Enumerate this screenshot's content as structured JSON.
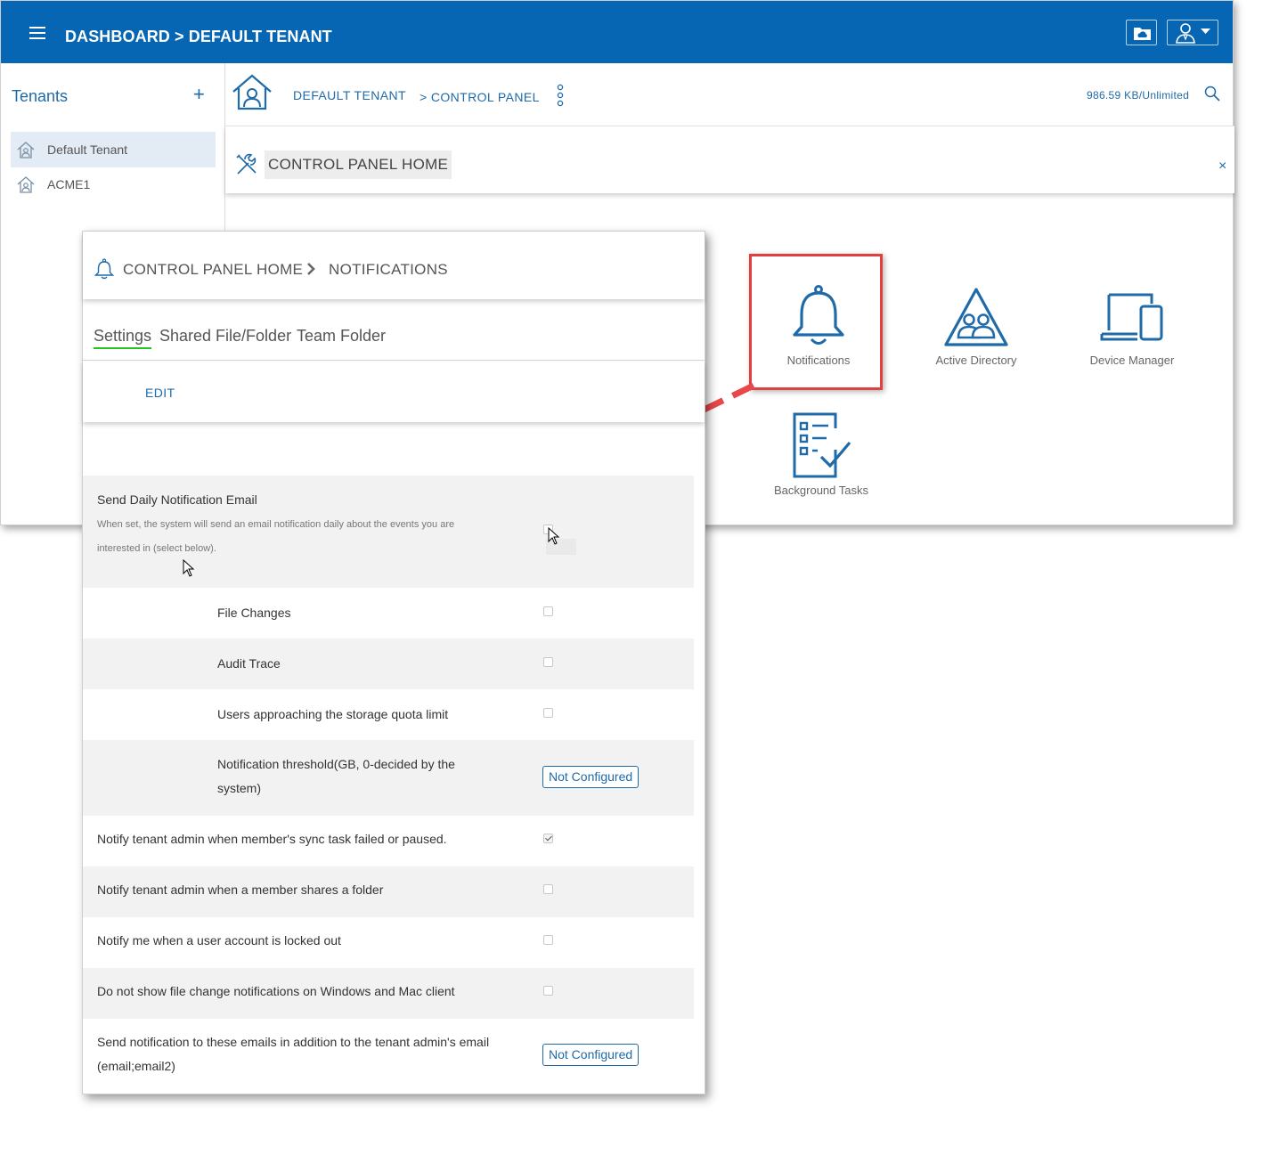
{
  "topbar": {
    "title": "DASHBOARD > DEFAULT TENANT"
  },
  "sidebar": {
    "title": "Tenants",
    "add_label": "+",
    "items": [
      {
        "label": "Default Tenant",
        "selected": true
      },
      {
        "label": "ACME1",
        "selected": false
      }
    ]
  },
  "breadcrumb": {
    "tenant": "DEFAULT TENANT",
    "control_panel": "> CONTROL PANEL"
  },
  "quota": "986.59 KB/Unlimited",
  "cp_header": {
    "title": "CONTROL PANEL HOME",
    "close_glyph": "×"
  },
  "tiles": [
    {
      "label": "Notifications",
      "icon": "bell-icon"
    },
    {
      "label": "Active Directory",
      "icon": "active-directory-icon"
    },
    {
      "label": "Device Manager",
      "icon": "device-manager-icon"
    },
    {
      "label": "Background Tasks",
      "icon": "checklist-icon"
    }
  ],
  "panel": {
    "crumb_home": "CONTROL PANEL HOME",
    "crumb_current": "NOTIFICATIONS",
    "tabs": [
      {
        "label": "Settings",
        "active": true
      },
      {
        "label": "Shared File/Folder",
        "active": false
      },
      {
        "label": "Team Folder",
        "active": false
      }
    ],
    "edit_label": "EDIT",
    "settings": [
      {
        "label": "Send Daily Notification Email",
        "desc_1": "When set, the system will send an email notification daily about the events you are",
        "desc_2": "interested in (select below).",
        "checked": false
      },
      {
        "label": "File Changes",
        "checked": false
      },
      {
        "label": "Audit Trace",
        "checked": false
      },
      {
        "label": "Users approaching the storage quota limit",
        "checked": false
      },
      {
        "label_1": "Notification threshold(GB, 0-decided by the",
        "label_2": "system)",
        "value": "Not Configured"
      },
      {
        "label": "Notify tenant admin when member's sync task failed or paused.",
        "checked": true
      },
      {
        "label": "Notify tenant admin when a member shares a folder",
        "checked": false
      },
      {
        "label": "Notify me when a user account is locked out",
        "checked": false
      },
      {
        "label": "Do not show file change notifications on Windows and Mac client",
        "checked": false
      },
      {
        "label_1": "Send notification to these emails in addition to the tenant admin's email",
        "label_2": "(email;email2)",
        "value": "Not Configured"
      }
    ]
  },
  "colors": {
    "brand_blue": "#0766b3",
    "link_blue": "#1f6aa8",
    "highlight_red": "#e04040",
    "tab_active_green": "#22c322"
  }
}
